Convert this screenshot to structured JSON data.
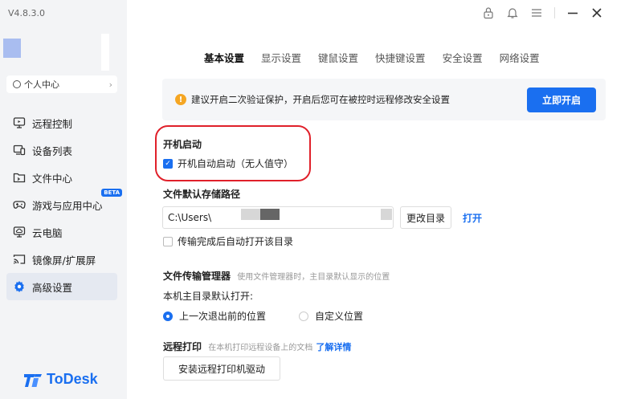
{
  "app": {
    "version": "V4.8.3.0",
    "brand": "ToDesk"
  },
  "sidebar": {
    "personal_center": "个人中心",
    "items": [
      {
        "label": "远程控制",
        "icon": "monitor-icon"
      },
      {
        "label": "设备列表",
        "icon": "device-list-icon"
      },
      {
        "label": "文件中心",
        "icon": "folder-icon"
      },
      {
        "label": "游戏与应用中心",
        "icon": "gamepad-icon",
        "badge": "BETA"
      },
      {
        "label": "云电脑",
        "icon": "cloud-pc-icon"
      },
      {
        "label": "镜像屏/扩展屏",
        "icon": "cast-screen-icon"
      },
      {
        "label": "高级设置",
        "icon": "gear-icon",
        "active": true
      }
    ]
  },
  "tabs": [
    "基本设置",
    "显示设置",
    "键鼠设置",
    "快捷键设置",
    "安全设置",
    "网络设置"
  ],
  "banner": {
    "text": "建议开启二次验证保护，开启后您可在被控时远程修改安全设置",
    "button": "立即开启"
  },
  "startup": {
    "title": "开机启动",
    "option": "开机自动启动（无人值守）",
    "checked": true
  },
  "storage": {
    "title": "文件默认存储路径",
    "path": "C:\\Users\\",
    "change_button": "更改目录",
    "open_link": "打开",
    "auto_open": "传输完成后自动打开该目录"
  },
  "file_manager": {
    "title": "文件传输管理器",
    "note": "使用文件管理器时，主目录默认显示的位置",
    "default_label": "本机主目录默认打开:",
    "options": [
      "上一次退出前的位置",
      "自定义位置"
    ],
    "selected": 0
  },
  "remote_print": {
    "title": "远程打印",
    "note": "在本机打印远程设备上的文档",
    "link": "了解详情",
    "button": "安装远程打印机驱动"
  },
  "colors": {
    "accent": "#1a6ff0",
    "highlight": "#e0202a",
    "warning": "#f5a623"
  }
}
